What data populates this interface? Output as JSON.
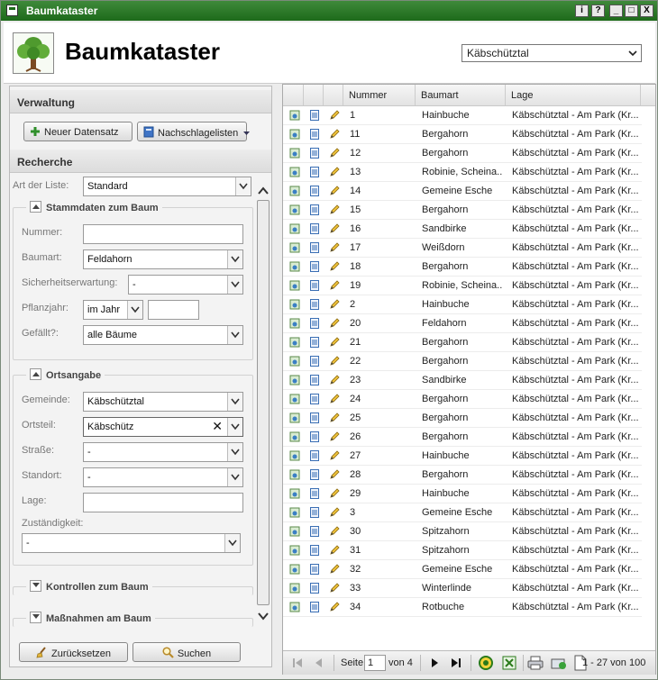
{
  "window": {
    "title": "Baumkataster",
    "buttons": [
      "i",
      "?",
      "_",
      "□",
      "X"
    ]
  },
  "header": {
    "app_title": "Baumkataster",
    "municipality_select": "Käbschütztal"
  },
  "left": {
    "verwaltung_title": "Verwaltung",
    "new_record_label": "Neuer Datensatz",
    "lookup_lists_label": "Nachschlagelisten",
    "recherche_title": "Recherche",
    "list_type_label": "Art der Liste:",
    "list_type_value": "Standard",
    "stammdaten": {
      "legend": "Stammdaten zum Baum",
      "nummer_label": "Nummer:",
      "nummer_value": "",
      "baumart_label": "Baumart:",
      "baumart_value": "Feldahorn",
      "sicherheit_label": "Sicherheitserwartung:",
      "sicherheit_value": "-",
      "pflanzjahr_label": "Pflanzjahr:",
      "pflanzjahr_mode": "im Jahr",
      "pflanzjahr_value": "",
      "gefaellt_label": "Gefällt?:",
      "gefaellt_value": "alle Bäume"
    },
    "ortsangabe": {
      "legend": "Ortsangabe",
      "gemeinde_label": "Gemeinde:",
      "gemeinde_value": "Käbschütztal",
      "ortsteil_label": "Ortsteil:",
      "ortsteil_value": "Käbschütz",
      "strasse_label": "Straße:",
      "strasse_value": "-",
      "standort_label": "Standort:",
      "standort_value": "-",
      "lage_label": "Lage:",
      "lage_value": "",
      "zustaendigkeit_label": "Zuständigkeit:",
      "zustaendigkeit_value": "-"
    },
    "kontrollen_legend": "Kontrollen zum Baum",
    "massnahmen_legend": "Maßnahmen am Baum",
    "reset_label": "Zurücksetzen",
    "search_label": "Suchen"
  },
  "table": {
    "columns": [
      "Nummer",
      "Baumart",
      "Lage"
    ],
    "rows": [
      {
        "nummer": "1",
        "baumart": "Hainbuche",
        "lage": "Käbschütztal - Am Park (Kr..."
      },
      {
        "nummer": "11",
        "baumart": "Bergahorn",
        "lage": "Käbschütztal - Am Park (Kr..."
      },
      {
        "nummer": "12",
        "baumart": "Bergahorn",
        "lage": "Käbschütztal - Am Park (Kr..."
      },
      {
        "nummer": "13",
        "baumart": "Robinie, Scheina...",
        "lage": "Käbschütztal - Am Park (Kr..."
      },
      {
        "nummer": "14",
        "baumart": "Gemeine Esche",
        "lage": "Käbschütztal - Am Park (Kr..."
      },
      {
        "nummer": "15",
        "baumart": "Bergahorn",
        "lage": "Käbschütztal - Am Park (Kr..."
      },
      {
        "nummer": "16",
        "baumart": "Sandbirke",
        "lage": "Käbschütztal - Am Park (Kr..."
      },
      {
        "nummer": "17",
        "baumart": "Weißdorn",
        "lage": "Käbschütztal - Am Park (Kr..."
      },
      {
        "nummer": "18",
        "baumart": "Bergahorn",
        "lage": "Käbschütztal - Am Park (Kr..."
      },
      {
        "nummer": "19",
        "baumart": "Robinie, Scheina...",
        "lage": "Käbschütztal - Am Park (Kr..."
      },
      {
        "nummer": "2",
        "baumart": "Hainbuche",
        "lage": "Käbschütztal - Am Park (Kr..."
      },
      {
        "nummer": "20",
        "baumart": "Feldahorn",
        "lage": "Käbschütztal - Am Park (Kr..."
      },
      {
        "nummer": "21",
        "baumart": "Bergahorn",
        "lage": "Käbschütztal - Am Park (Kr..."
      },
      {
        "nummer": "22",
        "baumart": "Bergahorn",
        "lage": "Käbschütztal - Am Park (Kr..."
      },
      {
        "nummer": "23",
        "baumart": "Sandbirke",
        "lage": "Käbschütztal - Am Park (Kr..."
      },
      {
        "nummer": "24",
        "baumart": "Bergahorn",
        "lage": "Käbschütztal - Am Park (Kr..."
      },
      {
        "nummer": "25",
        "baumart": "Bergahorn",
        "lage": "Käbschütztal - Am Park (Kr..."
      },
      {
        "nummer": "26",
        "baumart": "Bergahorn",
        "lage": "Käbschütztal - Am Park (Kr..."
      },
      {
        "nummer": "27",
        "baumart": "Hainbuche",
        "lage": "Käbschütztal - Am Park (Kr..."
      },
      {
        "nummer": "28",
        "baumart": "Bergahorn",
        "lage": "Käbschütztal - Am Park (Kr..."
      },
      {
        "nummer": "29",
        "baumart": "Hainbuche",
        "lage": "Käbschütztal - Am Park (Kr..."
      },
      {
        "nummer": "3",
        "baumart": "Gemeine Esche",
        "lage": "Käbschütztal - Am Park (Kr..."
      },
      {
        "nummer": "30",
        "baumart": "Spitzahorn",
        "lage": "Käbschütztal - Am Park (Kr..."
      },
      {
        "nummer": "31",
        "baumart": "Spitzahorn",
        "lage": "Käbschütztal - Am Park (Kr..."
      },
      {
        "nummer": "32",
        "baumart": "Gemeine Esche",
        "lage": "Käbschütztal - Am Park (Kr..."
      },
      {
        "nummer": "33",
        "baumart": "Winterlinde",
        "lage": "Käbschütztal - Am Park (Kr..."
      },
      {
        "nummer": "34",
        "baumart": "Rotbuche",
        "lage": "Käbschütztal - Am Park (Kr..."
      }
    ]
  },
  "pager": {
    "page_label": "Seite",
    "page_value": "1",
    "of_label": "von 4",
    "summary": "1 - 27 von 100"
  },
  "colors": {
    "titlebar": "#1d6a1a",
    "accent_green": "#3f8a3b"
  }
}
